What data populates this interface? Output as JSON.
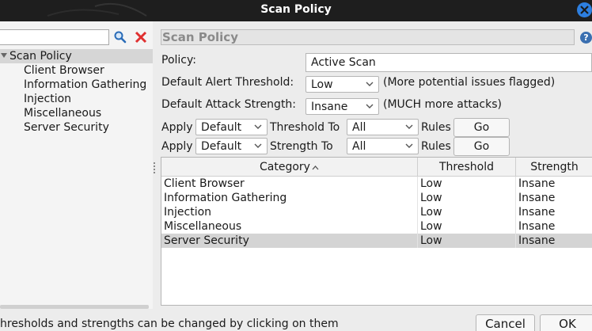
{
  "window": {
    "title": "Scan Policy"
  },
  "sidebar": {
    "root_label": "Scan Policy",
    "items": [
      {
        "label": "Client Browser"
      },
      {
        "label": "Information Gathering"
      },
      {
        "label": "Injection"
      },
      {
        "label": "Miscellaneous"
      },
      {
        "label": "Server Security"
      }
    ]
  },
  "panel": {
    "header": "Scan Policy",
    "policy_label": "Policy:",
    "policy_value": "Active Scan",
    "threshold_label": "Default Alert Threshold:",
    "threshold_value": "Low",
    "threshold_note": "(More potential issues flagged)",
    "strength_label": "Default Attack Strength:",
    "strength_value": "Insane",
    "strength_note": "(MUCH more attacks)",
    "apply_rows": [
      {
        "apply_label": "Apply",
        "apply_value": "Default",
        "to_label": "Threshold To",
        "to_value": "All",
        "rules_label": "Rules",
        "go_label": "Go"
      },
      {
        "apply_label": "Apply",
        "apply_value": "Default",
        "to_label": "Strength To",
        "to_value": "All",
        "rules_label": "Rules",
        "go_label": "Go"
      }
    ]
  },
  "table": {
    "columns": [
      "Category",
      "Threshold",
      "Strength"
    ],
    "sorted_column": "Category",
    "rows": [
      {
        "category": "Client Browser",
        "threshold": "Low",
        "strength": "Insane"
      },
      {
        "category": "Information Gathering",
        "threshold": "Low",
        "strength": "Insane"
      },
      {
        "category": "Injection",
        "threshold": "Low",
        "strength": "Insane"
      },
      {
        "category": "Miscellaneous",
        "threshold": "Low",
        "strength": "Insane"
      },
      {
        "category": "Server Security",
        "threshold": "Low",
        "strength": "Insane"
      }
    ],
    "selected_row": "Server Security"
  },
  "footer": {
    "status": "hresholds and strengths can be changed by clicking on them",
    "cancel_label": "Cancel",
    "ok_label": "OK"
  },
  "icons": {
    "search": "search-icon",
    "clear": "clear-icon",
    "help": "help-icon",
    "close": "close-icon"
  },
  "colors": {
    "titlebar": "#1e1e1e",
    "close_button": "#2d7fe0",
    "selection": "#d4d4d4",
    "clear_icon": "#e03030"
  }
}
